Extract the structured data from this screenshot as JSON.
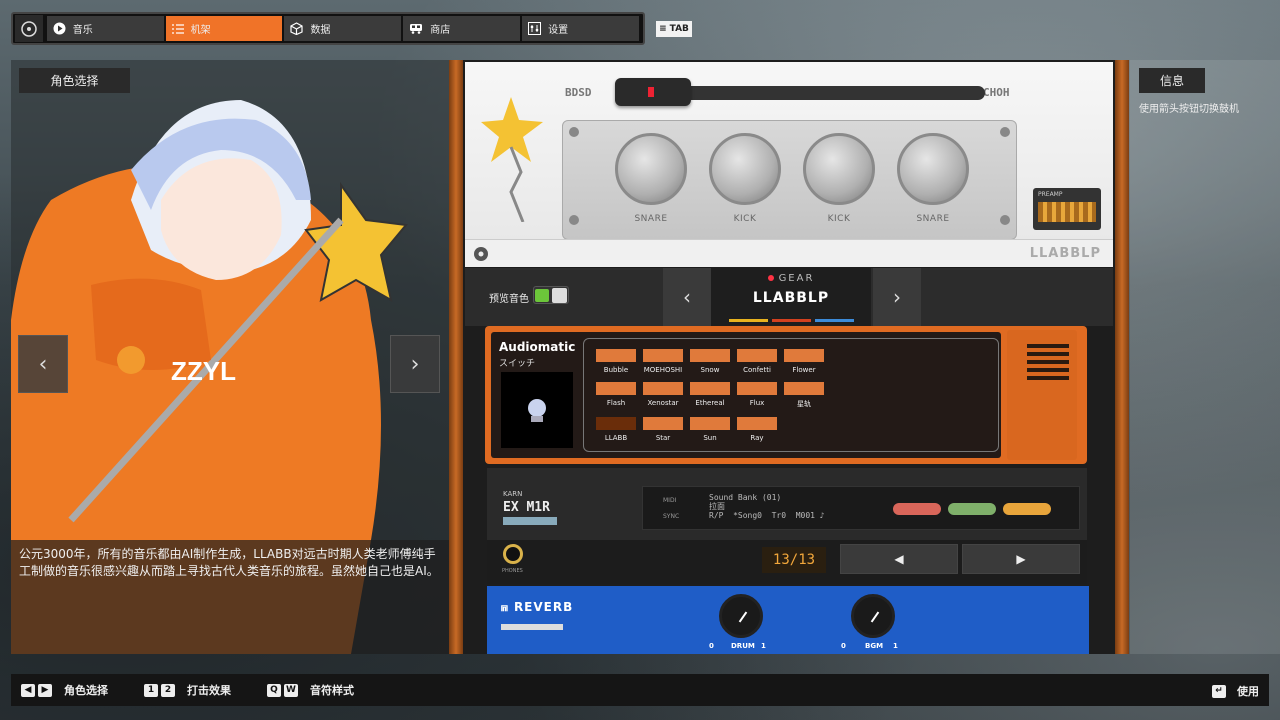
{
  "nav": {
    "tabs": [
      {
        "label": "音乐",
        "icon": "play-icon"
      },
      {
        "label": "机架",
        "icon": "list-icon",
        "active": true
      },
      {
        "label": "数据",
        "icon": "cube-icon"
      },
      {
        "label": "商店",
        "icon": "bus-icon"
      },
      {
        "label": "设置",
        "icon": "sliders-icon"
      }
    ],
    "tab_key": "TAB"
  },
  "left": {
    "title": "角色选择",
    "prev": "‹",
    "next": "›",
    "description": "公元3000年，所有的音乐都由AI制作生成，LLABB对远古时期人类老师傅纯手工制做的音乐很感兴趣从而踏上寻找古代人类音乐的旅程。虽然她自己也是AI。"
  },
  "drum": {
    "left_label": "BDSD",
    "right_label": "CHOH",
    "knobs": [
      "SNARE",
      "KICK",
      "KICK",
      "SNARE"
    ],
    "preamp": "PREAMP",
    "name": "LLABBLP"
  },
  "gear": {
    "preview_label": "预览音色",
    "tag": "GEAR",
    "name": "LLABBLP",
    "prev": "‹",
    "next": "›",
    "colors": [
      "#e8b31f",
      "#d3411f",
      "#3c8bd9"
    ]
  },
  "audiomatic": {
    "title": "Audiomatic",
    "subtitle": "スイッチ",
    "buttons": [
      "Bubble",
      "MOEHOSHI",
      "Snow",
      "Confetti",
      "Flower",
      "Flash",
      "Xenostar",
      "Ethereal",
      "Flux",
      "星轨",
      "LLABB",
      "Star",
      "Sun",
      "Ray"
    ],
    "selected": "LLABB"
  },
  "karn": {
    "brand": "KARN",
    "model": "EX M1R",
    "midi": "MIDI",
    "sync": "SYNC",
    "lcd_line1": "Sound Bank (01)",
    "lcd_line2": "拉面",
    "lcd_line3": "R/P  *Song0  Tr0  M001 ♪",
    "phones": "PHONES",
    "counter": "13/13",
    "prev_btn": "◀",
    "next_btn": "▶"
  },
  "reverb": {
    "title": "REVERB",
    "knobs": [
      {
        "label": "DRUM",
        "min": "0",
        "max": "1"
      },
      {
        "label": "BGM",
        "min": "0",
        "max": "1"
      }
    ]
  },
  "info": {
    "title": "信息",
    "hint": "使用箭头按钮切换鼓机"
  },
  "bottom": {
    "hints": [
      {
        "keys": [
          "◀",
          "▶"
        ],
        "label": "角色选择"
      },
      {
        "keys": [
          "1",
          "2"
        ],
        "label": "打击效果"
      },
      {
        "keys": [
          "Q",
          "W"
        ],
        "label": "音符样式"
      }
    ],
    "use_label": "使用"
  }
}
